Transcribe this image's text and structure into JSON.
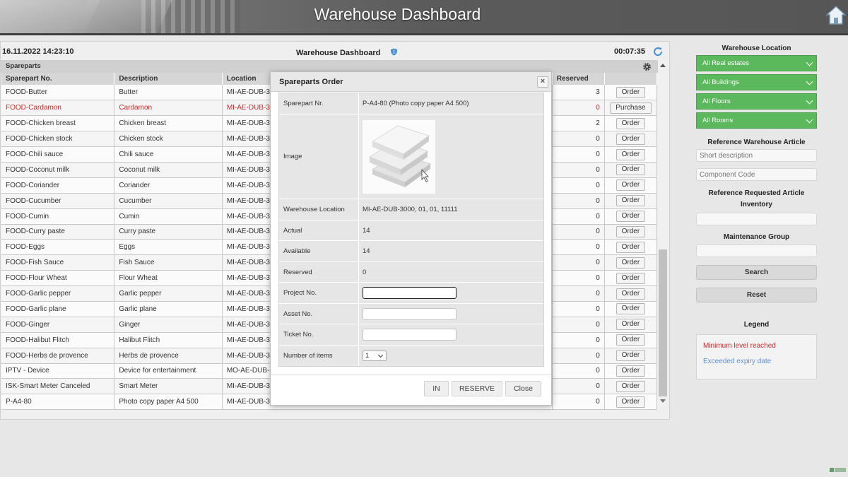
{
  "header": {
    "title": "Warehouse Dashboard",
    "home_icon": "home-icon"
  },
  "infobar": {
    "datetime": "16.11.2022 14:23:10",
    "title": "Warehouse Dashboard",
    "timer": "00:07:35"
  },
  "section": {
    "label": "Spareparts"
  },
  "table": {
    "headers": {
      "no": "Sparepart No.",
      "desc": "Description",
      "loc": "Location",
      "reserved": "Reserved"
    },
    "rows": [
      {
        "no": "FOOD-Butter",
        "desc": "Butter",
        "loc": "MI-AE-DUB-3000",
        "reserved": "3",
        "action": "Order",
        "red": false
      },
      {
        "no": "FOOD-Cardamon",
        "desc": "Cardamon",
        "loc": "MI-AE-DUB-3000",
        "reserved": "0",
        "action": "Purchase",
        "red": true
      },
      {
        "no": "FOOD-Chicken breast",
        "desc": "Chicken breast",
        "loc": "MI-AE-DUB-3000",
        "reserved": "2",
        "action": "Order",
        "red": false
      },
      {
        "no": "FOOD-Chicken stock",
        "desc": "Chicken stock",
        "loc": "MI-AE-DUB-3000",
        "reserved": "0",
        "action": "Order",
        "red": false
      },
      {
        "no": "FOOD-Chili sauce",
        "desc": "Chili sauce",
        "loc": "MI-AE-DUB-3000",
        "reserved": "0",
        "action": "Order",
        "red": false
      },
      {
        "no": "FOOD-Coconut milk",
        "desc": "Coconut milk",
        "loc": "MI-AE-DUB-3000",
        "reserved": "0",
        "action": "Order",
        "red": false
      },
      {
        "no": "FOOD-Coriander",
        "desc": "Coriander",
        "loc": "MI-AE-DUB-3000",
        "reserved": "0",
        "action": "Order",
        "red": false
      },
      {
        "no": "FOOD-Cucumber",
        "desc": "Cucumber",
        "loc": "MI-AE-DUB-3000",
        "reserved": "0",
        "action": "Order",
        "red": false
      },
      {
        "no": "FOOD-Cumin",
        "desc": "Cumin",
        "loc": "MI-AE-DUB-3000",
        "reserved": "0",
        "action": "Order",
        "red": false
      },
      {
        "no": "FOOD-Curry paste",
        "desc": "Curry paste",
        "loc": "MI-AE-DUB-3000",
        "reserved": "0",
        "action": "Order",
        "red": false
      },
      {
        "no": "FOOD-Eggs",
        "desc": "Eggs",
        "loc": "MI-AE-DUB-3000",
        "reserved": "0",
        "action": "Order",
        "red": false
      },
      {
        "no": "FOOD-Fish Sauce",
        "desc": "Fish Sauce",
        "loc": "MI-AE-DUB-3000",
        "reserved": "0",
        "action": "Order",
        "red": false
      },
      {
        "no": "FOOD-Flour Wheat",
        "desc": "Flour Wheat",
        "loc": "MI-AE-DUB-3000",
        "reserved": "0",
        "action": "Order",
        "red": false
      },
      {
        "no": "FOOD-Garlic pepper",
        "desc": "Garlic pepper",
        "loc": "MI-AE-DUB-3000",
        "reserved": "0",
        "action": "Order",
        "red": false
      },
      {
        "no": "FOOD-Garlic plane",
        "desc": "Garlic plane",
        "loc": "MI-AE-DUB-3000",
        "reserved": "0",
        "action": "Order",
        "red": false
      },
      {
        "no": "FOOD-Ginger",
        "desc": "Ginger",
        "loc": "MI-AE-DUB-3000",
        "reserved": "0",
        "action": "Order",
        "red": false
      },
      {
        "no": "FOOD-Halibut Flitch",
        "desc": "Halibut Flitch",
        "loc": "MI-AE-DUB-3000",
        "reserved": "0",
        "action": "Order",
        "red": false
      },
      {
        "no": "FOOD-Herbs de provence",
        "desc": "Herbs de provence",
        "loc": "MI-AE-DUB-3000",
        "reserved": "0",
        "action": "Order",
        "red": false
      },
      {
        "no": "IPTV - Device",
        "desc": "Device for entertainment",
        "loc": "MO-AE-DUB-3007",
        "reserved": "0",
        "action": "Order",
        "red": false
      },
      {
        "no": "ISK-Smart Meter Canceled",
        "desc": "Smart Meter",
        "loc": "MI-AE-DUB-3000",
        "reserved": "0",
        "action": "Order",
        "red": false
      },
      {
        "no": "P-A4-80",
        "desc": "Photo copy paper A4 500",
        "loc": "MI-AE-DUB-3000",
        "reserved": "0",
        "action": "Order",
        "red": false
      }
    ]
  },
  "modal": {
    "title": "Spareparts Order",
    "close_glyph": "×",
    "fields": {
      "sparepart_label": "Sparepart Nr.",
      "sparepart_value": "P-A4-80 (Photo copy paper A4 500)",
      "image_label": "Image",
      "location_label": "Warehouse Location",
      "location_value": "MI-AE-DUB-3000, 01, 01, 11111",
      "actual_label": "Actual",
      "actual_value": "14",
      "available_label": "Available",
      "available_value": "14",
      "reserved_label": "Reserved",
      "reserved_value": "0",
      "project_label": "Project No.",
      "project_value": "",
      "asset_label": "Asset No.",
      "asset_value": "",
      "ticket_label": "Ticket No.",
      "ticket_value": "",
      "items_label": "Number of items",
      "items_value": "1"
    },
    "buttons": {
      "in": "IN",
      "reserve": "RESERVE",
      "close": "Close"
    }
  },
  "filters": {
    "location_title": "Warehouse Location",
    "dropdowns": [
      "All Real estates",
      "All Buildings",
      "All Floors",
      "All Rooms"
    ],
    "article_title": "Reference Warehouse Article",
    "short_desc_placeholder": "Short description",
    "component_placeholder": "Component Code",
    "requested_title": "Reference Requested Article Inventory",
    "maintenance_title": "Maintenance Group",
    "search_label": "Search",
    "reset_label": "Reset"
  },
  "legend": {
    "title": "Legend",
    "min_level": "Minimum level reached",
    "expiry": "Exceeded expiry date"
  },
  "colors": {
    "green": "#5cb85c",
    "red": "#cc2d2d",
    "blue": "#5b8fd6"
  }
}
